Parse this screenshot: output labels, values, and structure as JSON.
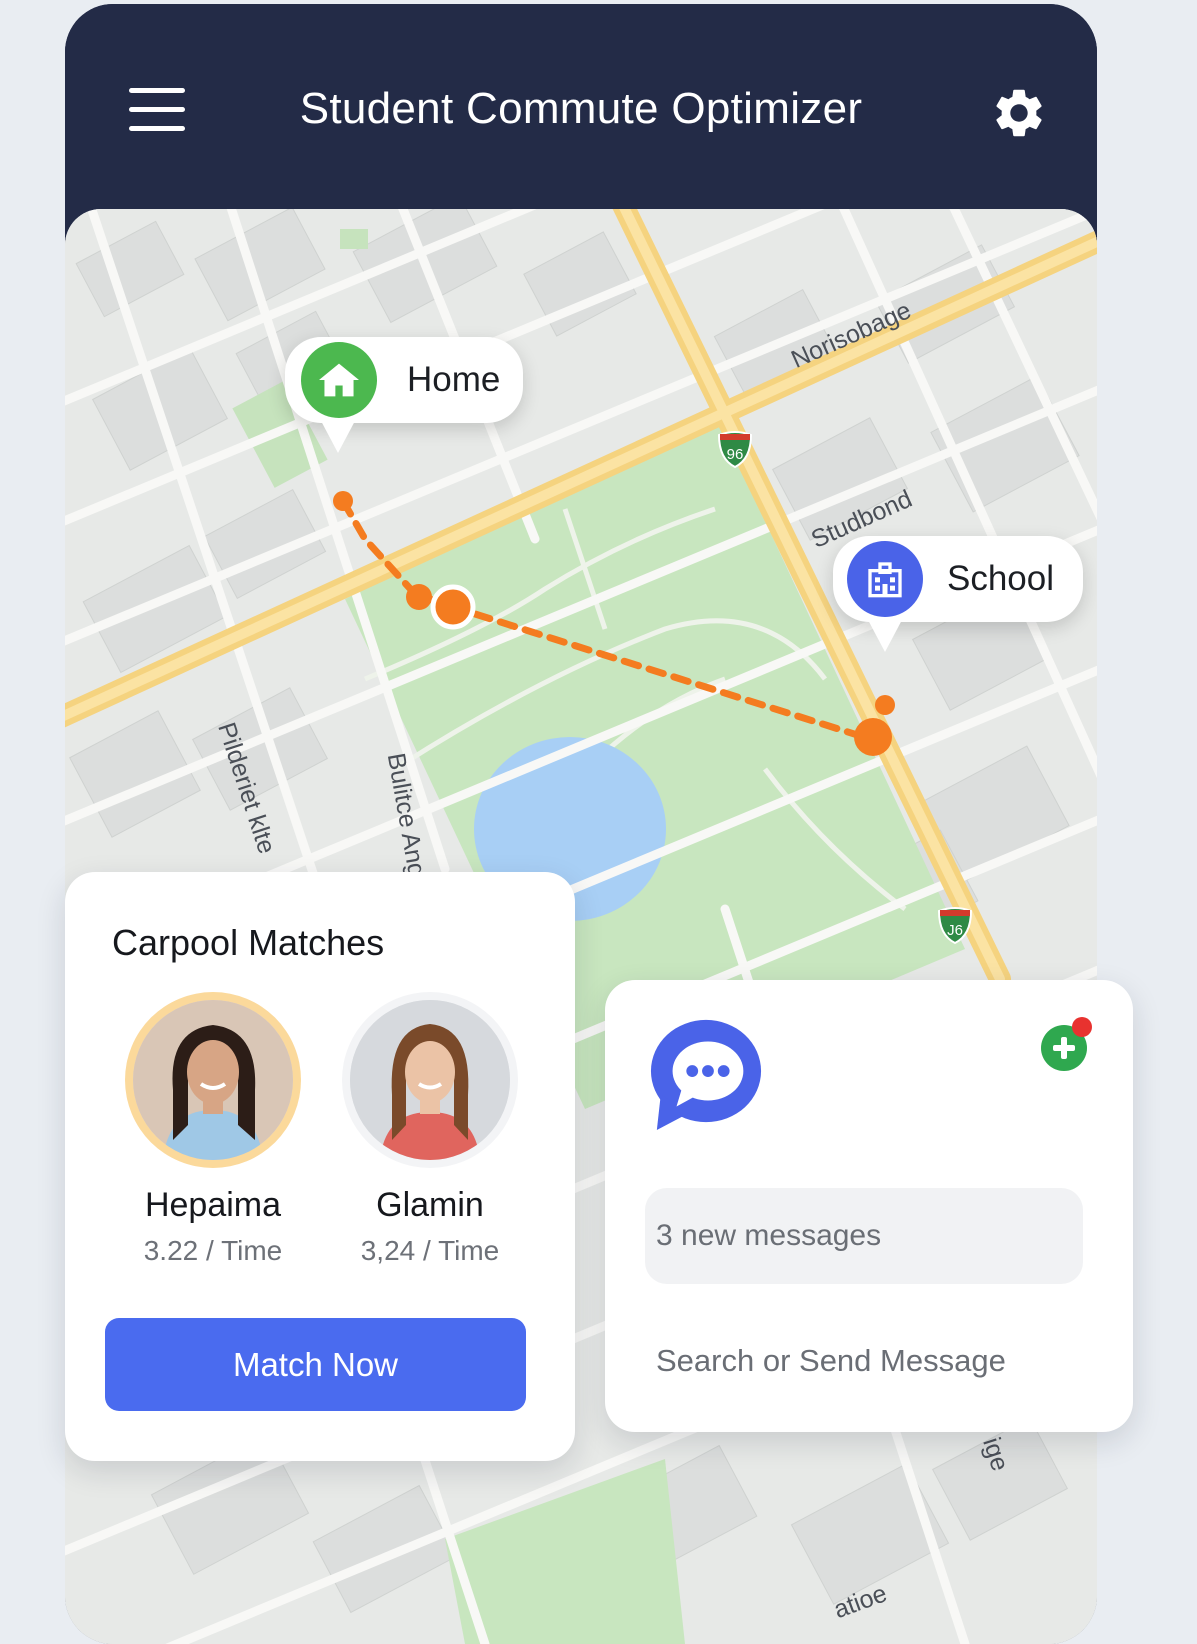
{
  "header": {
    "title": "Student Commute Optimizer",
    "menu_icon": "hamburger-menu-icon",
    "settings_icon": "gear-icon"
  },
  "map": {
    "street_labels": [
      "Norisobage",
      "Studbond",
      "Pilderiet klte",
      "Bulitce Ang",
      "ige",
      "atioe"
    ],
    "highway_shields": [
      "96",
      "J6"
    ],
    "pins": {
      "home": {
        "label": "Home",
        "icon": "house-icon"
      },
      "school": {
        "label": "School",
        "icon": "school-building-icon"
      }
    },
    "route_color": "#f47c20"
  },
  "carpool": {
    "title": "Carpool Matches",
    "matches": [
      {
        "name": "Hepaima",
        "time": "3.22 / Time"
      },
      {
        "name": "Glamin",
        "time": "3,24 / Time"
      }
    ],
    "action_label": "Match Now"
  },
  "messages": {
    "chat_icon": "chat-bubble-icon",
    "add_icon": "add-contact-icon",
    "new_count_text": "3 new messages",
    "input_placeholder": "Search or Send Message"
  },
  "colors": {
    "header_bg": "#232b47",
    "accent": "#4a6bef",
    "home_green": "#4cb84f",
    "school_blue": "#4a63e8",
    "route_orange": "#f47c20"
  }
}
